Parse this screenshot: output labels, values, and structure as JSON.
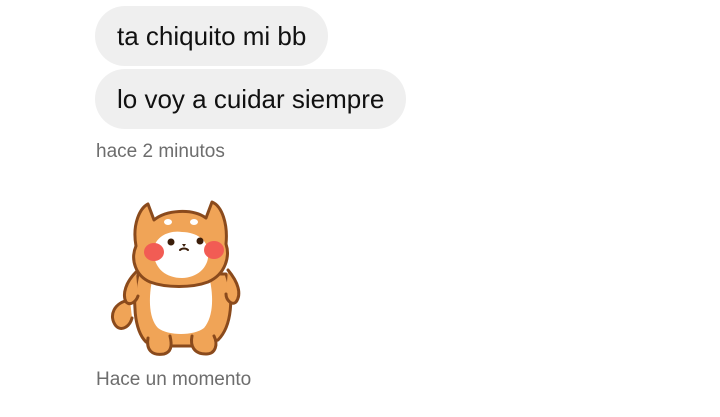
{
  "messages": [
    {
      "text": "ta chiquito mi bb"
    },
    {
      "text": "lo voy a cuidar siempre"
    }
  ],
  "timestamps": {
    "first_group": "hace 2 minutos",
    "sticker": "Hace un momento"
  },
  "sticker": {
    "icon": "shiba-dog-sticker-icon",
    "colors": {
      "fur": "#f0a457",
      "outline": "#8a4a1c",
      "belly": "#ffffff",
      "cheeks": "#f25c54"
    }
  },
  "colors": {
    "bubble_bg": "#efefef",
    "text": "#111111",
    "timestamp": "#6d6d6d"
  }
}
